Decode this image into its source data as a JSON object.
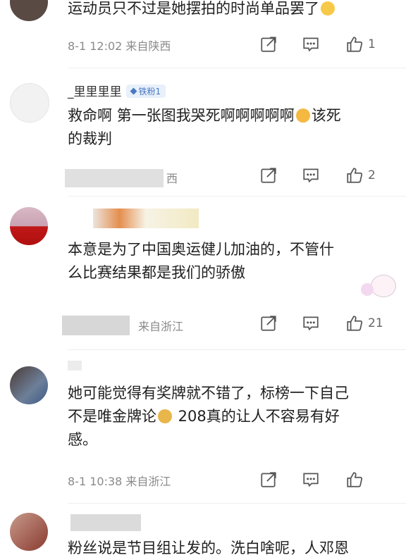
{
  "comments": [
    {
      "username": "",
      "badge": "",
      "text": "运动员只不过是她摆拍的时尚单品罢了",
      "emoji": "thinking-face",
      "date": "8-1 12:02",
      "location": "来自陕西",
      "likes": "1"
    },
    {
      "username": "_里里里里",
      "badge": "铁粉1",
      "text_line1": "救命啊 第一张图我哭死啊啊啊啊啊",
      "emoji": "crying-face",
      "text_line1_tail": "该死",
      "text_line2": "的裁判",
      "meta_visible": "西",
      "likes": "2"
    },
    {
      "username": "",
      "text_line1": "本意是为了中国奥运健儿加油的，不管什",
      "text_line2": "么比赛结果都是我们的骄傲",
      "meta_visible": "来自浙江",
      "likes": "21"
    },
    {
      "username": "",
      "text_line1": "她可能觉得有奖牌就不错了，标榜一下自己",
      "text_line2_head": "不是唯金牌论",
      "emoji": "doge",
      "text_line2_tail": " 208真的让人不容易有好",
      "text_line3": "感。",
      "date": "8-1 10:38",
      "location": "来自浙江",
      "likes": ""
    },
    {
      "username": "",
      "text_line1": "粉丝说是节目组让发的。洗白啥呢，人邓恩"
    }
  ],
  "icons": {
    "share": "share-icon",
    "comment": "comment-icon",
    "like": "thumbs-up-icon"
  },
  "colors": {
    "text": "#1f1f1f",
    "meta": "#8a8a8a",
    "icon": "#555555",
    "badge": "#4a78c2"
  }
}
